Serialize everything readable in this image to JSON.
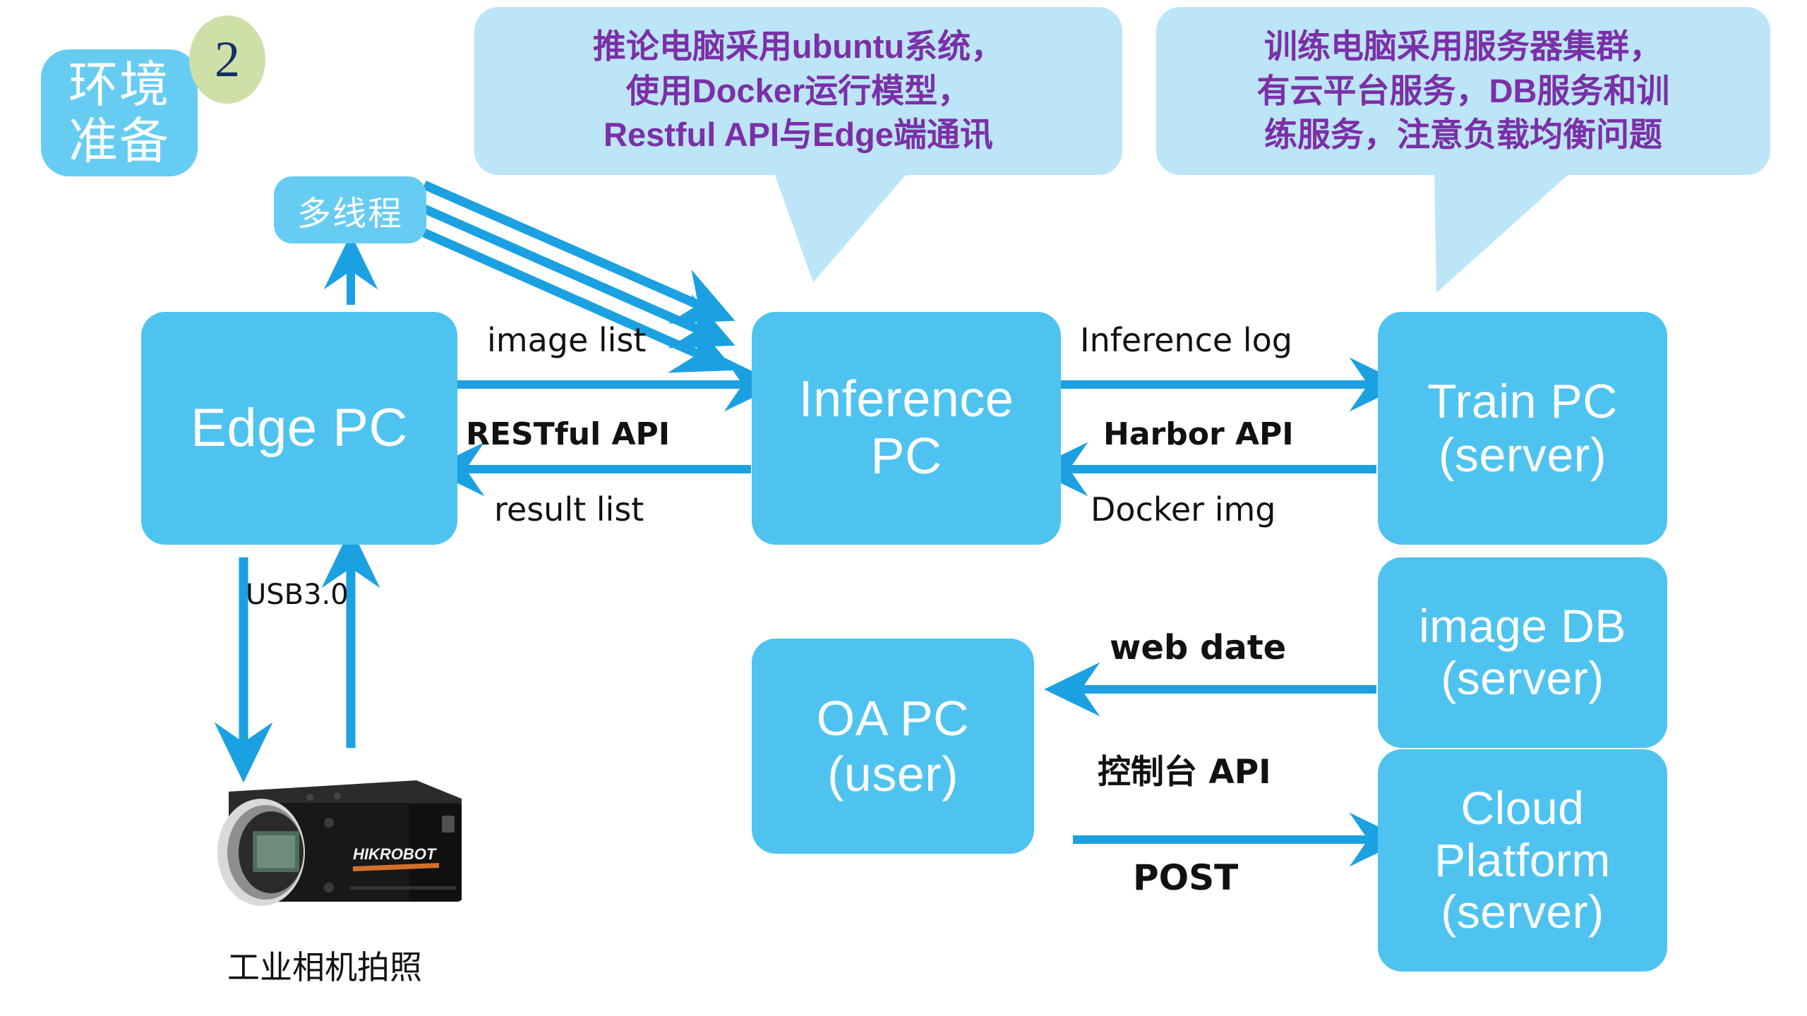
{
  "section": {
    "label": "环境\n准备",
    "step_number": "2",
    "chip_color": "#67CCF2",
    "badge_color": "#CFDFA8",
    "badge_text_color": "#14306B"
  },
  "callouts": [
    {
      "id": "inference-note",
      "text": "推论电脑采用ubuntu系统，\n使用Docker运行模型，\nRestful API与Edge端通讯",
      "bg": "#BCE5F7",
      "fg": "#7B2FA8"
    },
    {
      "id": "train-note",
      "text": "训练电脑采用服务器集群，\n有云平台服务，DB服务和训\n练服务，注意负载均衡问题",
      "bg": "#BCE5F7",
      "fg": "#7B2FA8"
    }
  ],
  "nodes": {
    "thread": {
      "label": "多线程"
    },
    "edge_pc": {
      "label": "Edge PC"
    },
    "inference_pc": {
      "label": "Inference\nPC"
    },
    "train_pc": {
      "label": "Train PC\n(server)"
    },
    "image_db": {
      "label": "image DB\n(server)"
    },
    "cloud_platform": {
      "label": "Cloud\nPlatform\n(server)"
    },
    "oa_pc": {
      "label": "OA PC\n(user)"
    }
  },
  "edge_labels": {
    "image_list": "image list",
    "restful_api": "RESTful API",
    "result_list": "result list",
    "inference_log": "Inference log",
    "harbor_api": "Harbor API",
    "docker_img": "Docker img",
    "web_date": "web date",
    "console_api": "控制台 API",
    "post": "POST",
    "usb": "USB3.0"
  },
  "camera": {
    "brand": "HIKROBOT",
    "caption": "工业相机拍照"
  },
  "colors": {
    "node_blue": "#4EC3F0",
    "chip_blue": "#67CCF2",
    "callout_blue": "#BCE5F7",
    "arrow_blue": "#1BA1E2",
    "purple_text": "#7B2FA8",
    "green_badge": "#CFDFA8",
    "navy": "#14306B",
    "background": "#FFFFFF"
  }
}
